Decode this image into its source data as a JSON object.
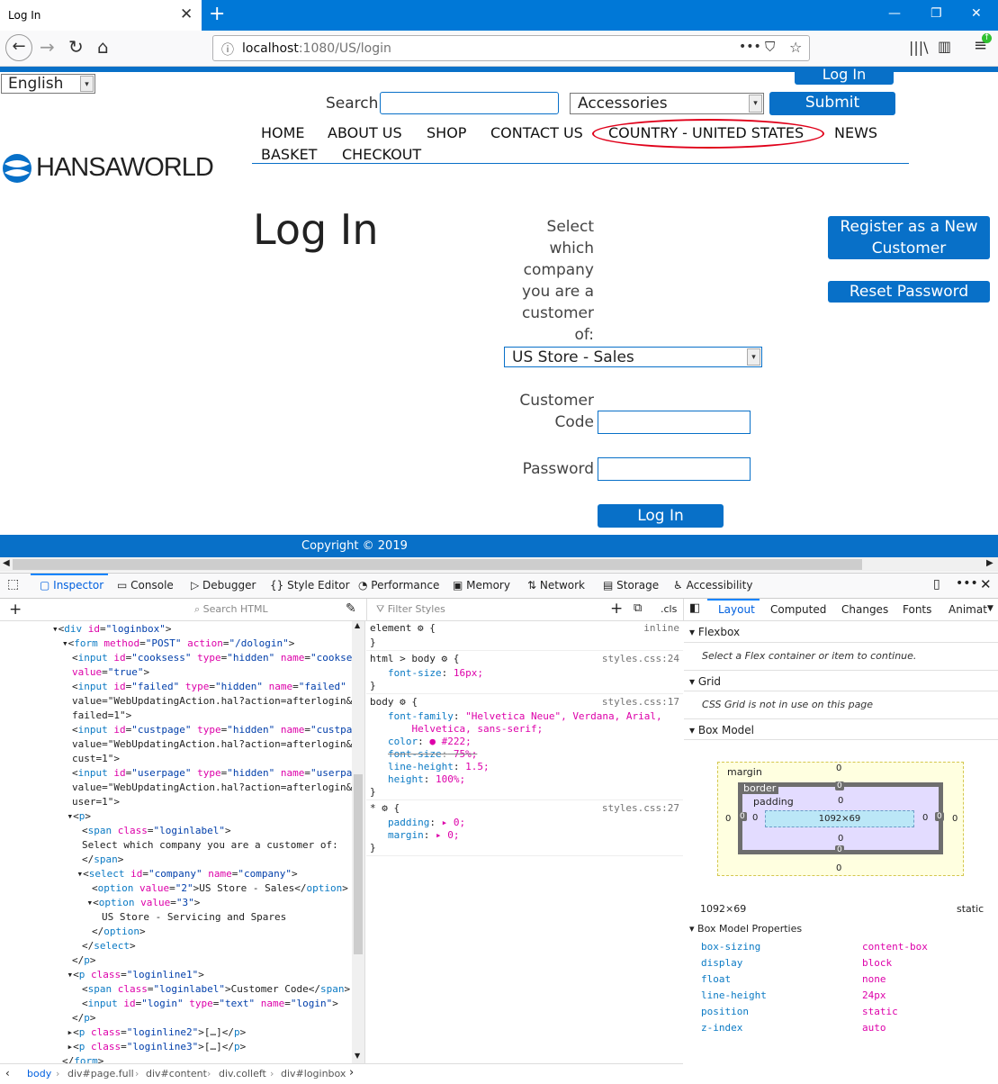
{
  "browser": {
    "tab_title": "Log In",
    "tab_close": "✕",
    "new_tab": "+",
    "win_min": "—",
    "win_max": "❐",
    "win_close": "✕",
    "url_host": "localhost",
    "url_path": ":1080/US/login",
    "url_more": "•••"
  },
  "site": {
    "language": "English",
    "top_login": "Log In",
    "search_label": "Search",
    "search_value": "",
    "category": "Accessories",
    "submit": "Submit",
    "logo": "HANSAWORLD",
    "menu": [
      "HOME",
      "ABOUT US",
      "SHOP",
      "CONTACT US",
      "COUNTRY - UNITED STATES",
      "NEWS"
    ],
    "menu2": [
      "BASKET",
      "CHECKOUT"
    ],
    "page_title": "Log In",
    "company_label_lines": [
      "Select",
      "which",
      "company",
      "you are a",
      "customer",
      "of:"
    ],
    "company_value": "US Store - Sales",
    "customer_code_lines": [
      "Customer",
      "Code"
    ],
    "password_label": "Password",
    "login_button": "Log In",
    "register_lines": [
      "Register as a New",
      "Customer"
    ],
    "reset_password": "Reset Password",
    "footer": "Copyright © 2019"
  },
  "devtools": {
    "tabs": [
      "Inspector",
      "Console",
      "Debugger",
      "Style Editor",
      "Performance",
      "Memory",
      "Network",
      "Storage",
      "Accessibility"
    ],
    "search_html": "Search HTML",
    "filter_styles": "Filter Styles",
    "cls": ".cls",
    "layout_tabs": [
      "Layout",
      "Computed",
      "Changes",
      "Fonts",
      "Animat"
    ],
    "markup": [
      {
        "indent": 0,
        "t": "▾<div id=\"loginbox\">"
      },
      {
        "indent": 1,
        "t": "▾<form method=\"POST\" action=\"/dologin\">"
      },
      {
        "indent": 2,
        "t": "<input id=\"cooksess\" type=\"hidden\" name=\"cooksess\""
      },
      {
        "indent": 2,
        "t": "value=\"true\">"
      },
      {
        "indent": 2,
        "t": "<input id=\"failed\" type=\"hidden\" name=\"failed\""
      },
      {
        "indent": 2,
        "t": "value=\"WebUpdatingAction.hal?action=afterlogin&"
      },
      {
        "indent": 2,
        "t": "failed=1\">"
      },
      {
        "indent": 2,
        "t": "<input id=\"custpage\" type=\"hidden\" name=\"custpage\""
      },
      {
        "indent": 2,
        "t": "value=\"WebUpdatingAction.hal?action=afterlogin&"
      },
      {
        "indent": 2,
        "t": "cust=1\">"
      },
      {
        "indent": 2,
        "t": "<input id=\"userpage\" type=\"hidden\" name=\"userpage\""
      },
      {
        "indent": 2,
        "t": "value=\"WebUpdatingAction.hal?action=afterlogin&"
      },
      {
        "indent": 2,
        "t": "user=1\">"
      },
      {
        "indent": 1.5,
        "t": "▾<p>"
      },
      {
        "indent": 3,
        "t": "<span class=\"loginlabel\">"
      },
      {
        "indent": 3,
        "t": "Select which company you are a customer of:"
      },
      {
        "indent": 3,
        "t": "</span>"
      },
      {
        "indent": 2.5,
        "t": "▾<select id=\"company\" name=\"company\">"
      },
      {
        "indent": 4,
        "t": "<option value=\"2\">US Store - Sales</option>"
      },
      {
        "indent": 3.5,
        "t": "▾<option value=\"3\">"
      },
      {
        "indent": 5,
        "t": "US Store - Servicing and Spares"
      },
      {
        "indent": 4,
        "t": "</option>"
      },
      {
        "indent": 3,
        "t": "</select>"
      },
      {
        "indent": 2,
        "t": "</p>"
      },
      {
        "indent": 1.5,
        "t": "▾<p class=\"loginline1\">"
      },
      {
        "indent": 3,
        "t": "<span class=\"loginlabel\">Customer Code</span>"
      },
      {
        "indent": 3,
        "t": "<input id=\"login\" type=\"text\" name=\"login\">"
      },
      {
        "indent": 2,
        "t": "</p>"
      },
      {
        "indent": 1.5,
        "t": "▸<p class=\"loginline2\">[…]</p>"
      },
      {
        "indent": 1.5,
        "t": "▸<p class=\"loginline3\">[…]</p>"
      },
      {
        "indent": 1,
        "t": "</form>"
      },
      {
        "indent": 0.5,
        "t": "</div>"
      }
    ],
    "rules": [
      {
        "sel": "element ⚙ {",
        "src": "inline",
        "props": [],
        "close": "}"
      },
      {
        "sel": "html > body ⚙ {",
        "src": "styles.css:24",
        "props": [
          [
            "font-size",
            "16px;"
          ]
        ],
        "close": "}"
      },
      {
        "sel": "body ⚙ {",
        "src": "styles.css:17",
        "props": [
          [
            "font-family",
            "\"Helvetica Neue\", Verdana, Arial,"
          ],
          [
            "",
            "    Helvetica, sans-serif;"
          ],
          [
            "color",
            "● #222;"
          ],
          [
            "font-size",
            "75%;"
          ],
          [
            "line-height",
            "1.5;"
          ],
          [
            "height",
            "100%;"
          ]
        ],
        "close": "}"
      },
      {
        "sel": "* ⚙ {",
        "src": "styles.css:27",
        "props": [
          [
            "padding",
            "▸ 0;"
          ],
          [
            "margin",
            "▸ 0;"
          ]
        ],
        "close": "}"
      }
    ],
    "flexbox": "Flexbox",
    "flex_note": "Select a Flex container or item to continue.",
    "grid": "Grid",
    "grid_note": "CSS Grid is not in use on this page",
    "boxmodel": "Box Model",
    "bm_margin": "margin",
    "bm_border": "border",
    "bm_padding": "padding",
    "bm_content": "1092×69",
    "bm_zero": "0",
    "bm_size": "1092×69",
    "bm_position": "static",
    "bm_props_title": "Box Model Properties",
    "bm_props": [
      [
        "box-sizing",
        "content-box"
      ],
      [
        "display",
        "block"
      ],
      [
        "float",
        "none"
      ],
      [
        "line-height",
        "24px"
      ],
      [
        "position",
        "static"
      ],
      [
        "z-index",
        "auto"
      ]
    ],
    "breadcrumbs": [
      "body",
      "div#page.full",
      "div#content",
      "div.colleft",
      "div#loginbox"
    ]
  },
  "colors": {
    "brand": "#0870c8",
    "highlight_circle": "#e0001a",
    "devtools_accent": "#0a84ff"
  }
}
